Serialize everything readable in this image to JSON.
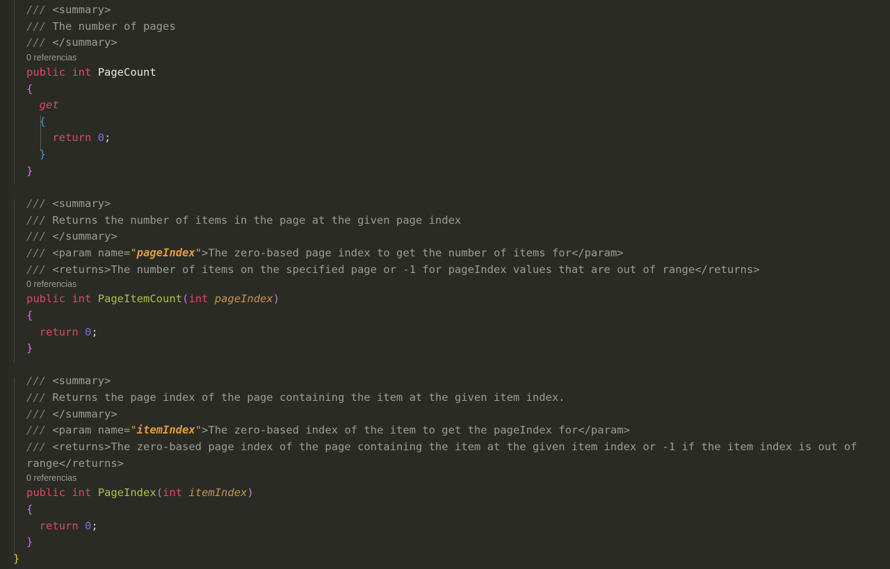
{
  "editor": {
    "language": "csharp",
    "theme_name": "dark-olive",
    "background_color": "#2b2b26",
    "gutter_color": "#272821",
    "default_text_color": "#d6d6cc",
    "font_size_px": 15.5,
    "line_height_px": 23.65
  },
  "codelens": {
    "page_count_label": "0 referencias",
    "page_item_count_label": "0 referencias",
    "page_index_label": "0 referencias"
  },
  "colors": {
    "comment_slash": "#7d8466",
    "doc_text": "#9d9d93",
    "attribute_value": "#e09a3e",
    "keyword": "#e0485f",
    "property_name": "#e8e8e0",
    "method_name": "#a6c349",
    "parameter_name": "#c4954d",
    "number": "#7a6fd6",
    "bracket_level_0": "#e8c547",
    "bracket_level_1": "#c678dd",
    "bracket_level_2": "#3f95d6"
  },
  "code": {
    "property_page_count": {
      "doc_open": "<summary>",
      "doc_text": "The number of pages",
      "doc_close": "</summary>",
      "modifier": "public",
      "type": "int",
      "name": "PageCount",
      "accessor": "get",
      "return_keyword": "return",
      "return_value": "0",
      "semicolon": ";"
    },
    "method_page_item_count": {
      "doc_open": "<summary>",
      "doc_text": "Returns the number of items in the page at the given page index",
      "doc_close": "</summary>",
      "param_tag_open": "<param name=",
      "param_name": "pageIndex",
      "param_tag_gt": ">",
      "param_desc": "The zero-based page index to get the number of items for",
      "param_tag_close": "</param>",
      "returns_tag_open": "<returns>",
      "returns_desc": "The number of items on the specified page or -1 for pageIndex values that are out of range",
      "returns_tag_close": "</returns>",
      "modifier": "public",
      "type": "int",
      "name": "PageItemCount",
      "param_type": "int",
      "param_ident": "pageIndex",
      "return_keyword": "return",
      "return_value": "0",
      "semicolon": ";"
    },
    "method_page_index": {
      "doc_open": "<summary>",
      "doc_text": "Returns the page index of the page containing the item at the given item index.",
      "doc_close": "</summary>",
      "param_tag_open": "<param name=",
      "param_name": "itemIndex",
      "param_tag_gt": ">",
      "param_desc": "The zero-based index of the item to get the pageIndex for",
      "param_tag_close": "</param>",
      "returns_tag_open": "<returns>",
      "returns_desc": "The zero-based page index of the page containing the item at the given item index or -1 if the item index is out of range",
      "returns_tag_close": "</returns>",
      "modifier": "public",
      "type": "int",
      "name": "PageIndex",
      "param_type": "int",
      "param_ident": "itemIndex",
      "return_keyword": "return",
      "return_value": "0",
      "semicolon": ";"
    },
    "punctuation": {
      "slashes": "///",
      "quote": "\"",
      "brace_open": "{",
      "brace_close": "}",
      "paren_open": "(",
      "paren_close": ")",
      "space": " "
    },
    "class_close_brace": "}"
  }
}
